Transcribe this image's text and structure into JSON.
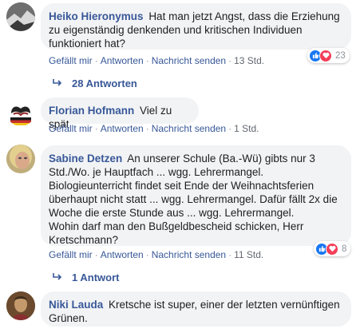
{
  "comments": [
    {
      "author": "Heiko Hieronymus",
      "text": "Hat man jetzt Angst, dass die Erziehung zu eigenständig denkenden und kritischen Individuen funktioniert hat?",
      "actions": [
        "Gefällt mir",
        "Antworten",
        "Nachricht senden",
        "13 Std."
      ],
      "reaction_count": "23",
      "replies": "28 Antworten"
    },
    {
      "author": "Florian Hofmann",
      "text": "Viel zu spät",
      "actions": [
        "Gefällt mir",
        "Antworten",
        "Nachricht senden",
        "1 Std."
      ]
    },
    {
      "author": "Sabine Detzen",
      "text": "An unserer Schule (Ba.-Wü) gibts nur 3 Std./Wo. je Hauptfach ... wgg. Lehrermangel. Biologieunterricht findet seit Ende der Weihnachtsferien überhaupt nicht statt ... wgg. Lehrermangel. Dafür fällt 2x die Woche die erste Stunde aus ... wgg. Lehrermangel.\nWohin darf man den Bußgeldbescheid schicken, Herr Kretschmann?",
      "actions": [
        "Gefällt mir",
        "Antworten",
        "Nachricht senden",
        "11 Std."
      ],
      "reaction_count": "8",
      "replies": "1 Antwort"
    },
    {
      "author": "Niki Lauda",
      "text": "Kretsche ist super, einer der letzten vernünftigen Grünen."
    }
  ],
  "icons": {
    "like": "like-icon",
    "love": "love-icon",
    "reply_arrow": "reply-arrow-icon"
  },
  "colors": {
    "link": "#385898",
    "bubble": "#f2f3f5",
    "like": "#1877f2",
    "love": "#f33e58"
  }
}
